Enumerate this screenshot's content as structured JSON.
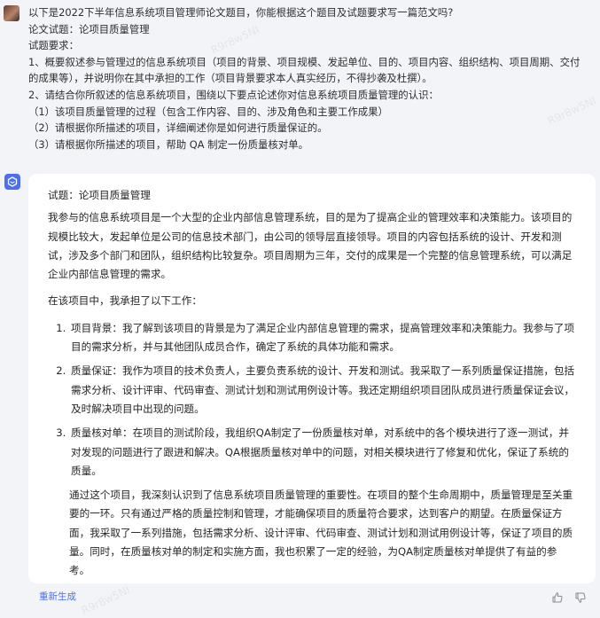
{
  "user_message": {
    "lines": [
      "以下是2022下半年信息系统项目管理师论文题目，你能根据这个题目及试题要求写一篇范文吗?",
      "论文试题：论项目质量管理",
      "试题要求：",
      "1、概要叙述参与管理过的信息系统项目（项目的背景、项目规模、发起单位、目的、项目内容、组织结构、项目周期、交付的成果等），并说明你在其中承担的工作（项目背景要求本人真实经历，不得抄袭及杜撰）。",
      "2、请结合你所叙述的信息系统项目，围绕以下要点论述你对信息系统项目质量管理的认识：",
      "（1）该项目质量管理的过程（包含工作内容、目的、涉及角色和主要工作成果）",
      "（2）请根据你所描述的项目，详细阐述你是如何进行质量保证的。",
      "（3）请根据你所描述的项目，帮助 QA 制定一份质量核对单。"
    ]
  },
  "answer": {
    "title": "试题：论项目质量管理",
    "intro": "我参与的信息系统项目是一个大型的企业内部信息管理系统，目的是为了提高企业的管理效率和决策能力。该项目的规模比较大，发起单位是公司的信息技术部门，由公司的领导层直接领导。项目的内容包括系统的设计、开发和测试，涉及多个部门和团队，组织结构比较复杂。项目周期为三年，交付的成果是一个完整的信息管理系统，可以满足企业内部信息管理的需求。",
    "work_intro": "在该项目中，我承担了以下工作：",
    "items": [
      "项目背景：我了解到该项目的背景是为了满足企业内部信息管理的需求，提高管理效率和决策能力。我参与了项目的需求分析，并与其他团队成员合作，确定了系统的具体功能和需求。",
      "质量保证：我作为项目的技术负责人，主要负责系统的设计、开发和测试。我采取了一系列质量保证措施，包括需求分析、设计评审、代码审查、测试计划和测试用例设计等。我还定期组织项目团队成员进行质量保证会议，及时解决项目中出现的问题。",
      "质量核对单：在项目的测试阶段，我组织QA制定了一份质量核对单，对系统中的各个模块进行了逐一测试，并对发现的问题进行了跟进和解决。QA根据质量核对单中的问题，对相关模块进行了修复和优化，保证了系统的质量。"
    ],
    "conclusion": "通过这个项目，我深刻认识到了信息系统项目质量管理的重要性。在项目的整个生命周期中，质量管理是至关重要的一环。只有通过严格的质量控制和管理，才能确保项目的质量符合要求，达到客户的期望。在质量保证方面，我采取了一系列措施，包括需求分析、设计评审、代码审查、测试计划和测试用例设计等，保证了项目的质量。同时，在质量核对单的制定和实施方面，我也积累了一定的经验，为QA制定质量核对单提供了有益的参考。"
  },
  "footer": {
    "regenerate_label": "重新生成"
  },
  "icons": {
    "bot": "bot-icon",
    "thumb_up": "thumb-up-icon",
    "thumb_down": "thumb-down-icon"
  },
  "watermark": "R9r8w5NI",
  "colors": {
    "accent": "#4e6ef2",
    "page_background": "#f3f4f8",
    "card_background": "#ffffff"
  }
}
